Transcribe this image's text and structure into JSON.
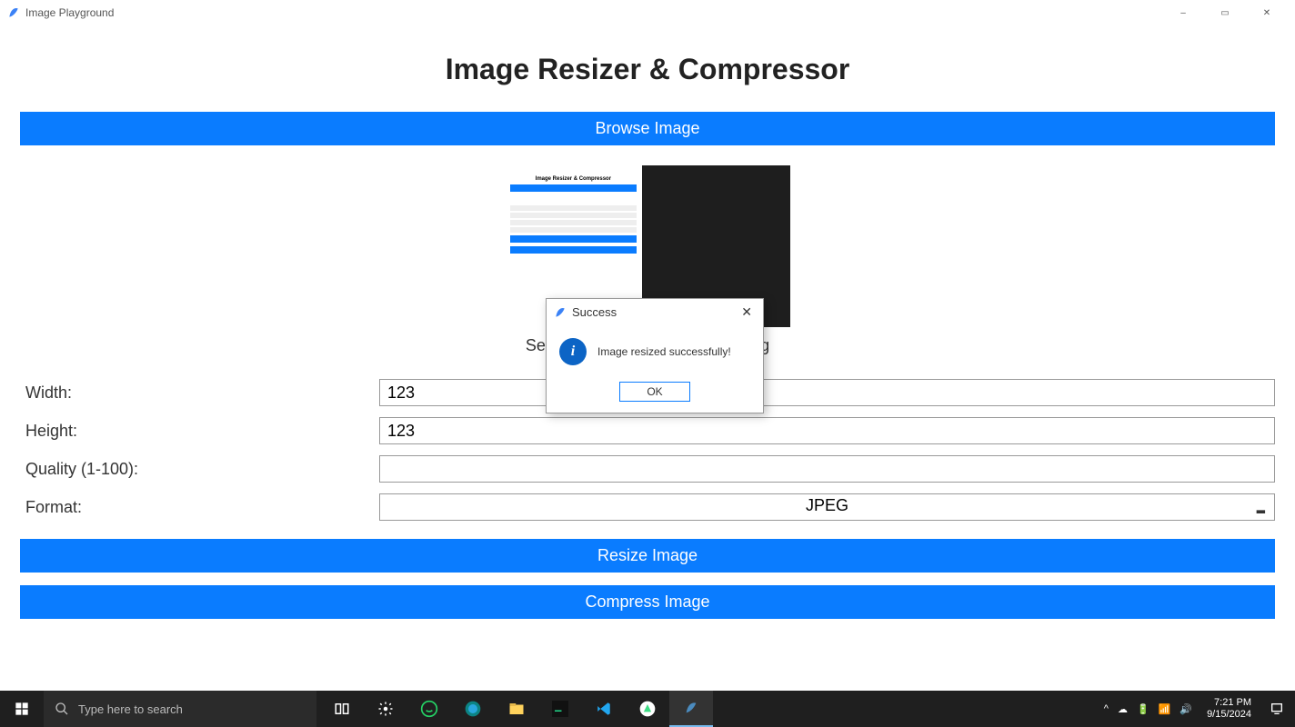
{
  "window": {
    "title": "Image Playground",
    "minimize": "–",
    "maximize": "▭",
    "close": "✕"
  },
  "page": {
    "heading": "Image Resizer & Compressor",
    "browse_button": "Browse Image",
    "selected_label_prefix": "Se",
    "selected_label_suffix": "g",
    "resize_button": "Resize Image",
    "compress_button": "Compress Image"
  },
  "form": {
    "width_label": "Width:",
    "width_value": "123",
    "height_label": "Height:",
    "height_value": "123",
    "quality_label": "Quality (1-100):",
    "quality_value": "",
    "format_label": "Format:",
    "format_value": "JPEG"
  },
  "dialog": {
    "title": "Success",
    "message": "Image resized successfully!",
    "ok": "OK",
    "close": "✕"
  },
  "preview_mini_title": "Image Resizer & Compressor",
  "taskbar": {
    "search_placeholder": "Type here to search",
    "time": "7:21 PM",
    "date": "9/15/2024"
  }
}
